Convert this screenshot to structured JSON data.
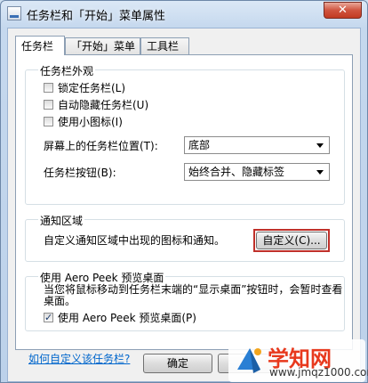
{
  "window": {
    "title": "任务栏和「开始」菜单属性",
    "close_glyph": "✕"
  },
  "tabs": [
    {
      "label": "任务栏",
      "active": true
    },
    {
      "label": "「开始」菜单",
      "active": false
    },
    {
      "label": "工具栏",
      "active": false
    }
  ],
  "appearance": {
    "title": "任务栏外观",
    "lock": {
      "label": "锁定任务栏(L)",
      "checked": false
    },
    "autohide": {
      "label": "自动隐藏任务栏(U)",
      "checked": false
    },
    "small_icons": {
      "label": "使用小图标(I)",
      "checked": false
    },
    "location_label": "屏幕上的任务栏位置(T):",
    "location_value": "底部",
    "buttons_label": "任务栏按钮(B):",
    "buttons_value": "始终合并、隐藏标签"
  },
  "notification": {
    "title": "通知区域",
    "text": "自定义通知区域中出现的图标和通知。",
    "customize_button": "自定义(C)...",
    "highlight_color": "#c0302a"
  },
  "aero_peek": {
    "title": "使用 Aero Peek 预览桌面",
    "description": "当您将鼠标移动到任务栏末端的“显示桌面”按钮时，会暂时查看桌面。",
    "checkbox": {
      "label": "使用 Aero Peek 预览桌面(P)",
      "checked": true
    }
  },
  "help_link": "如何自定义该任务栏?",
  "footer": {
    "ok_button": "确定"
  },
  "watermark": {
    "brand": "学知网",
    "url": "www.jmqz1000.com"
  }
}
